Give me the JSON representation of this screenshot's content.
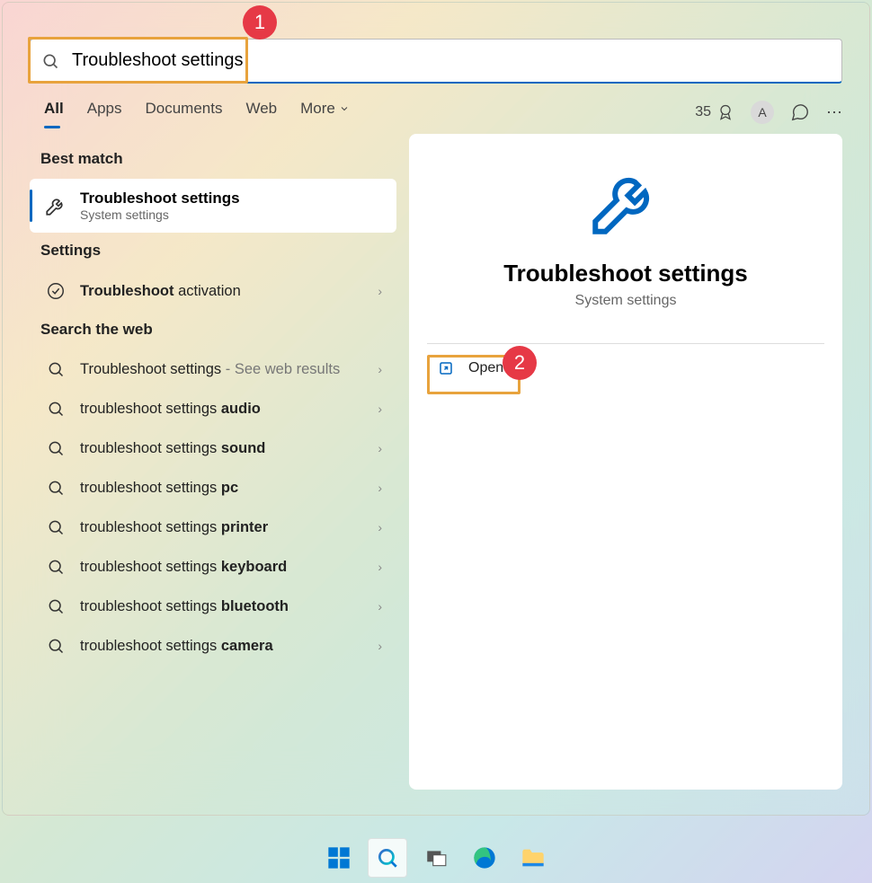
{
  "search": {
    "value": "Troubleshoot settings"
  },
  "tabs": {
    "all": "All",
    "apps": "Apps",
    "documents": "Documents",
    "web": "Web",
    "more": "More"
  },
  "rewards": {
    "count": "35",
    "avatar_initial": "A"
  },
  "sections": {
    "best_match": "Best match",
    "settings": "Settings",
    "search_web": "Search the web"
  },
  "best": {
    "title": "Troubleshoot settings",
    "subtitle": "System settings"
  },
  "settings_item": {
    "prefix_bold": "Troubleshoot",
    "rest": " activation"
  },
  "web": [
    {
      "prefix": "Troubleshoot settings",
      "suffix": " - See web results"
    },
    {
      "prefix": "troubleshoot settings ",
      "bold": "audio"
    },
    {
      "prefix": "troubleshoot settings ",
      "bold": "sound"
    },
    {
      "prefix": "troubleshoot settings ",
      "bold": "pc"
    },
    {
      "prefix": "troubleshoot settings ",
      "bold": "printer"
    },
    {
      "prefix": "troubleshoot settings ",
      "bold": "keyboard"
    },
    {
      "prefix": "troubleshoot settings ",
      "bold": "bluetooth"
    },
    {
      "prefix": "troubleshoot settings ",
      "bold": "camera"
    }
  ],
  "detail": {
    "title": "Troubleshoot settings",
    "subtitle": "System settings",
    "open": "Open"
  },
  "annotations": {
    "one": "1",
    "two": "2"
  }
}
